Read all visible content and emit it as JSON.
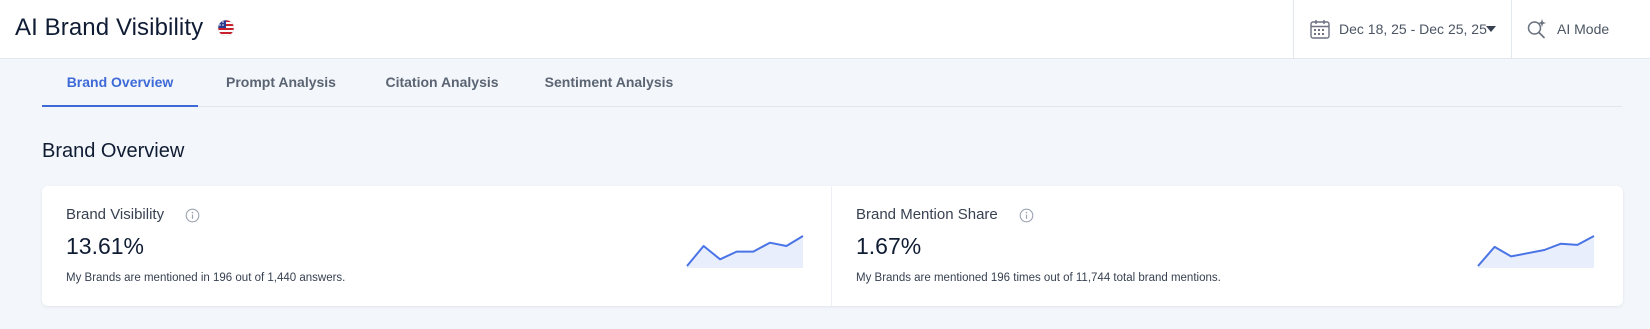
{
  "header": {
    "title": "AI Brand Visibility",
    "flag_icon": "us-flag-icon",
    "date_range": "Dec 18, 25 - Dec 25, 25",
    "mode_label": "AI Mode"
  },
  "tabs": [
    {
      "label": "Brand Overview",
      "active": true
    },
    {
      "label": "Prompt Analysis",
      "active": false
    },
    {
      "label": "Citation Analysis",
      "active": false
    },
    {
      "label": "Sentiment Analysis",
      "active": false
    }
  ],
  "section": {
    "title": "Brand Overview"
  },
  "metrics": [
    {
      "label": "Brand Visibility",
      "value": "13.61%",
      "description": "My Brands are mentioned in 196 out of 1,440 answers.",
      "trend": [
        11.2,
        13.0,
        11.8,
        12.5,
        12.5,
        13.3,
        13.0,
        13.9
      ]
    },
    {
      "label": "Brand Mention Share",
      "value": "1.67%",
      "description": "My Brands are mentioned 196 times out of 11,744 total brand mentions.",
      "trend": [
        1.2,
        1.5,
        1.35,
        1.4,
        1.45,
        1.55,
        1.53,
        1.67
      ]
    }
  ],
  "colors": {
    "accent": "#3e6ad8",
    "sparkline": "#4a74e6",
    "sparkline_fill": "#e8eefc"
  }
}
